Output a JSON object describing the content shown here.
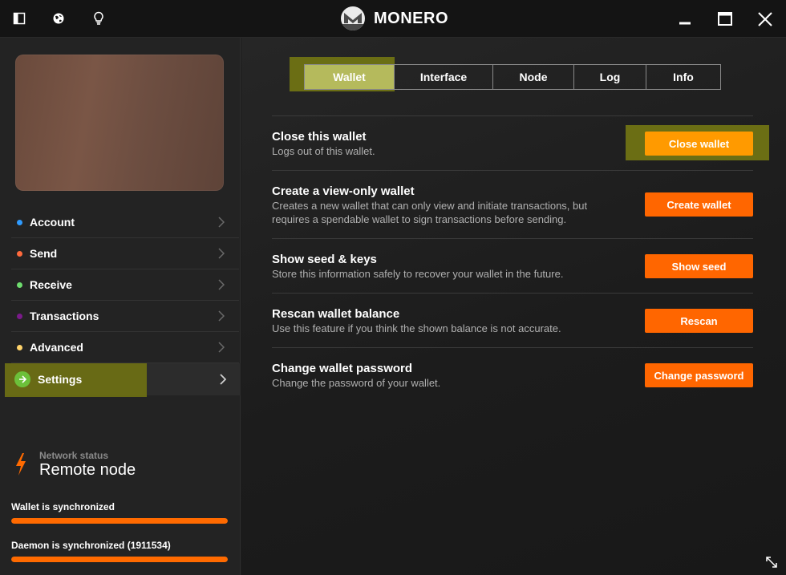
{
  "titlebar": {
    "brand": "MONERO",
    "icons": [
      "sidebar-toggle-icon",
      "globe-icon",
      "lightbulb-icon"
    ],
    "window_controls": [
      "minimize-icon",
      "maximize-icon",
      "close-icon"
    ]
  },
  "sidebar": {
    "items": [
      {
        "label": "Account",
        "color": "#2f9bff"
      },
      {
        "label": "Send",
        "color": "#ff6a3d"
      },
      {
        "label": "Receive",
        "color": "#6edc6e"
      },
      {
        "label": "Transactions",
        "color": "#7a1a8a"
      },
      {
        "label": "Advanced",
        "color": "#ffd36b"
      },
      {
        "label": "Settings",
        "color": "#6cc03a"
      }
    ],
    "network": {
      "caption": "Network status",
      "value": "Remote node"
    },
    "wallet_sync": {
      "label": "Wallet is synchronized",
      "progress": 1.0
    },
    "daemon_sync": {
      "label": "Daemon is synchronized (1911534)",
      "progress": 1.0
    }
  },
  "tabs": [
    "Wallet",
    "Interface",
    "Node",
    "Log",
    "Info"
  ],
  "active_tab": "Wallet",
  "settings": [
    {
      "title": "Close this wallet",
      "desc": [
        "Logs out of this wallet."
      ],
      "button": "Close wallet"
    },
    {
      "title": "Create a view-only wallet",
      "desc": [
        "Creates a new wallet that can only view and initiate transactions, but",
        "requires a spendable wallet to sign transactions before sending."
      ],
      "button": "Create wallet"
    },
    {
      "title": "Show seed & keys",
      "desc": [
        "Store this information safely to recover your wallet in the future."
      ],
      "button": "Show seed"
    },
    {
      "title": "Rescan wallet balance",
      "desc": [
        "Use this feature if you think the shown balance is not accurate."
      ],
      "button": "Rescan"
    },
    {
      "title": "Change wallet password",
      "desc": [
        "Change the password of your wallet."
      ],
      "button": "Change password"
    }
  ],
  "colors": {
    "accent": "#ff6600",
    "highlight": "#6b6e14"
  }
}
